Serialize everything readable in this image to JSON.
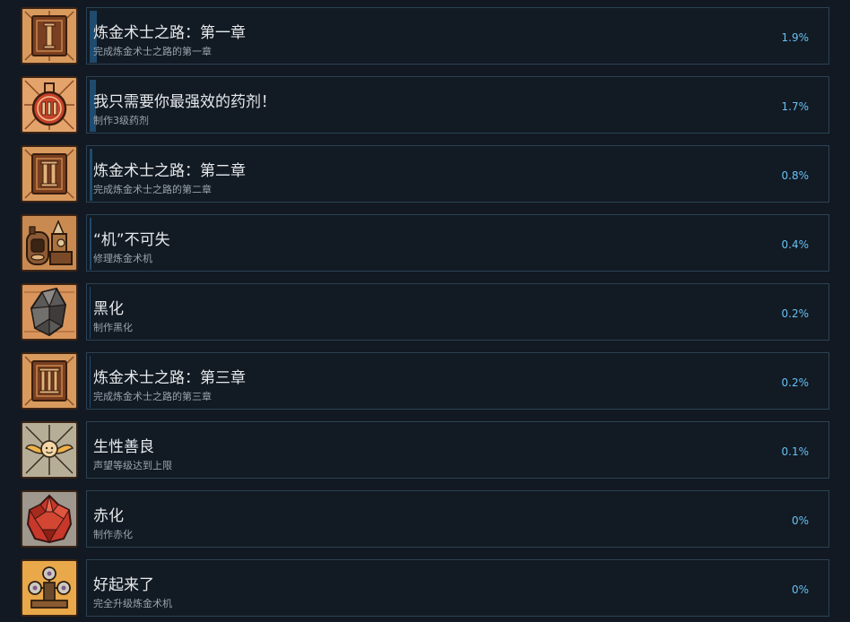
{
  "achievements": [
    {
      "title": "炼金术士之路：第一章",
      "description": "完成炼金术士之路的第一章",
      "percent": "1.9%",
      "progress_fraction": 0.019,
      "icon": "book-roman-one-icon"
    },
    {
      "title": "我只需要你最强效的药剂！",
      "description": "制作3级药剂",
      "percent": "1.7%",
      "progress_fraction": 0.017,
      "icon": "potion-flask-three-icon"
    },
    {
      "title": "炼金术士之路：第二章",
      "description": "完成炼金术士之路的第二章",
      "percent": "0.8%",
      "progress_fraction": 0.008,
      "icon": "book-roman-two-icon"
    },
    {
      "title": "“机”不可失",
      "description": "修理炼金术机",
      "percent": "0.4%",
      "progress_fraction": 0.004,
      "icon": "alchemy-machine-icon"
    },
    {
      "title": "黑化",
      "description": "制作黑化",
      "percent": "0.2%",
      "progress_fraction": 0.002,
      "icon": "black-crystal-icon"
    },
    {
      "title": "炼金术士之路：第三章",
      "description": "完成炼金术士之路的第三章",
      "percent": "0.2%",
      "progress_fraction": 0.002,
      "icon": "book-roman-three-icon"
    },
    {
      "title": "生性善良",
      "description": "声望等级达到上限",
      "percent": "0.1%",
      "progress_fraction": 0.001,
      "icon": "winged-angel-icon"
    },
    {
      "title": "赤化",
      "description": "制作赤化",
      "percent": "0%",
      "progress_fraction": 0,
      "icon": "red-crystal-icon"
    },
    {
      "title": "好起来了",
      "description": "完全升级炼金术机",
      "percent": "0%",
      "progress_fraction": 0,
      "icon": "upgraded-machine-icon"
    }
  ],
  "colors": {
    "background": "#121922",
    "panel_border": "#2b4255",
    "progress_fill": "#1f4b6e",
    "percent_text": "#66c0f4",
    "title_text": "#e6e9ec",
    "description_text": "#9aa4ae"
  }
}
